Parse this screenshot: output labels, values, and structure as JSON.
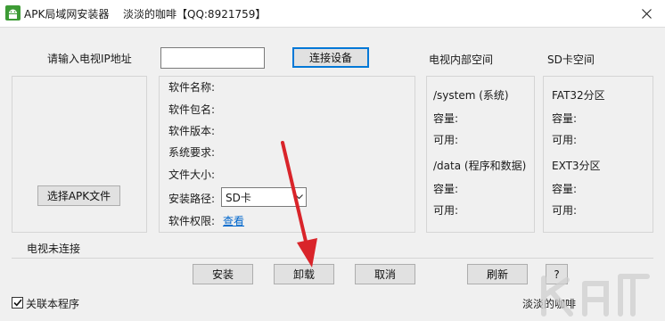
{
  "window": {
    "app_name": "APK局域网安装器",
    "subtitle": "淡淡的咖啡【QQ:8921759】",
    "close_glyph": "✕"
  },
  "connect": {
    "ip_label": "请输入电视IP地址",
    "ip_value": "",
    "connect_button": "连接设备"
  },
  "storage": {
    "tv_header": "电视内部空间",
    "sd_header": "SD卡空间",
    "system_title": "/system (系统)",
    "data_title": "/data (程序和数据)",
    "fat32_title": "FAT32分区",
    "ext3_title": "EXT3分区",
    "capacity_label": "容量:",
    "available_label": "可用:"
  },
  "apk_info": {
    "select_button": "选择APK文件",
    "fields": [
      "软件名称:",
      "软件包名:",
      "软件版本:",
      "系统要求:",
      "文件大小:"
    ],
    "install_path_label": "安装路径:",
    "install_path_value": "SD卡",
    "permission_label": "软件权限:",
    "permission_link": "查看"
  },
  "status": {
    "text": "电视未连接"
  },
  "actions": {
    "install": "安装",
    "uninstall": "卸载",
    "cancel": "取消",
    "refresh": "刷新",
    "help": "?"
  },
  "footer": {
    "checkbox_label": "关联本程序",
    "checkbox_checked": true,
    "author": "淡淡的咖啡"
  },
  "colors": {
    "annotation_arrow": "#d9242a",
    "accent": "#0078d7"
  }
}
